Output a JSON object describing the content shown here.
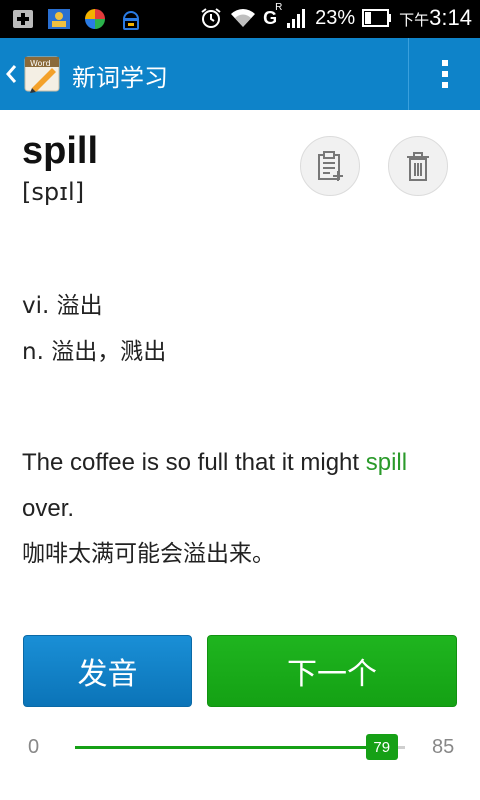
{
  "status_bar": {
    "battery_percent": "23%",
    "time_prefix": "下午",
    "time": "3:14",
    "icons": [
      "add-box-icon",
      "contacts-icon",
      "pinwheel-icon",
      "android-icon",
      "alarm-icon",
      "wifi-icon",
      "signal-icon",
      "battery-icon"
    ],
    "network_label": "G",
    "roaming_label": "R"
  },
  "app_bar": {
    "title": "新词学习",
    "back_icon": "back-arrow-icon",
    "menu_icon": "overflow-menu-icon",
    "color": "#0e83c9"
  },
  "word": {
    "text": "spill",
    "phonetic": "[spɪl]"
  },
  "meanings": [
    "vi. 溢出",
    "n. 溢出，溅出"
  ],
  "example": {
    "before": "The coffee is so full that it might ",
    "highlight": "spill",
    "after": " over.",
    "translation": "咖啡太满可能会溢出来。",
    "highlight_color": "#2a9a2a"
  },
  "actions": {
    "note_icon": "add-note-icon",
    "delete_icon": "trash-icon",
    "pronounce_label": "发音",
    "next_label": "下一个"
  },
  "progress": {
    "min_label": "0",
    "max_label": "85",
    "current_label": "79",
    "current": 79,
    "max": 85
  }
}
